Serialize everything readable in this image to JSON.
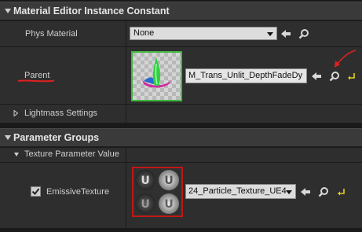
{
  "sections": {
    "material_editor": {
      "title": "Material Editor Instance Constant"
    },
    "parameter_groups": {
      "title": "Parameter Groups"
    }
  },
  "props": {
    "phys_material": {
      "label": "Phys Material",
      "value": "None"
    },
    "parent": {
      "label": "Parent",
      "value": "M_Trans_Unlit_DepthFadeDy"
    },
    "lightmass": {
      "label": "Lightmass Settings"
    },
    "texture_group": {
      "label": "Texture Parameter Value"
    },
    "emissive": {
      "label": "EmissiveTexture",
      "value": "24_Particle_Texture_UE4",
      "checked": true
    }
  },
  "colors": {
    "accent_green": "#3fb83f",
    "accent_red": "#c01818",
    "annotation_red": "#e02020",
    "reset_yellow": "#e8d020"
  },
  "icons": [
    "use-selected-arrow-icon",
    "browse-magnifier-icon",
    "reset-to-default-icon",
    "expand-arrow-icon",
    "collapse-arrow-icon",
    "checkbox-check-icon"
  ]
}
